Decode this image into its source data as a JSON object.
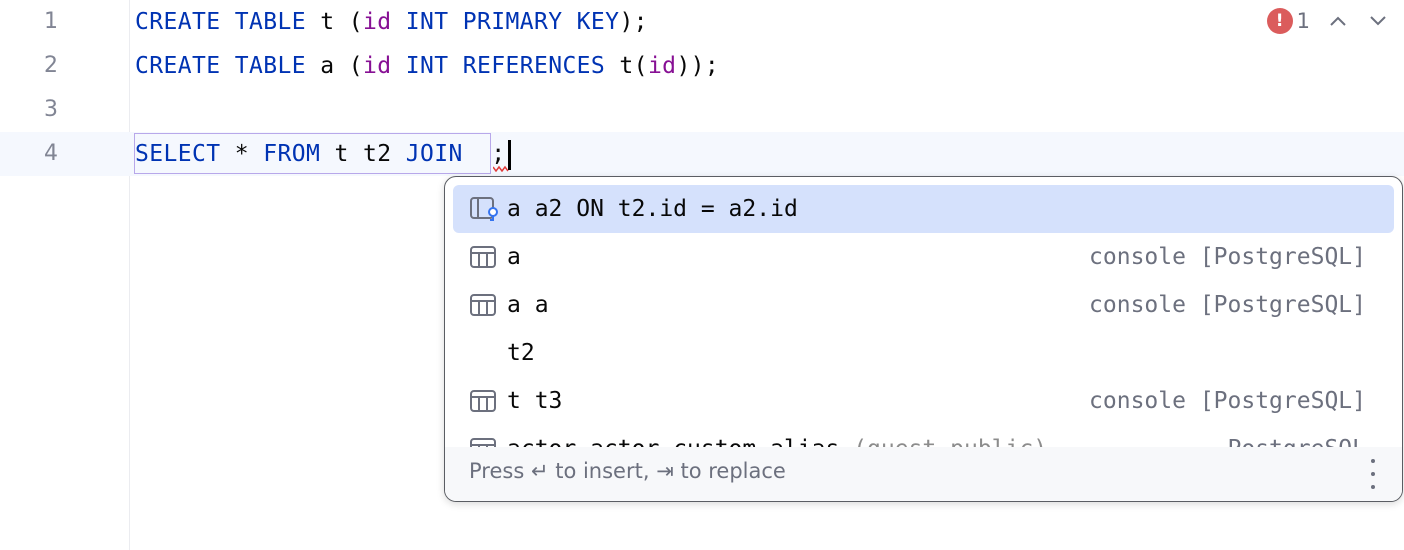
{
  "editor": {
    "line_numbers": [
      "1",
      "2",
      "3",
      "4"
    ],
    "lines": [
      {
        "tokens": [
          {
            "t": "CREATE TABLE",
            "c": "kw"
          },
          {
            "t": " t (",
            "c": ""
          },
          {
            "t": "id",
            "c": "fld"
          },
          {
            "t": " ",
            "c": ""
          },
          {
            "t": "INT PRIMARY KEY",
            "c": "kw"
          },
          {
            "t": ");",
            "c": ""
          }
        ]
      },
      {
        "tokens": [
          {
            "t": "CREATE TABLE",
            "c": "kw"
          },
          {
            "t": " a (",
            "c": ""
          },
          {
            "t": "id",
            "c": "fld"
          },
          {
            "t": " ",
            "c": ""
          },
          {
            "t": "INT REFERENCES",
            "c": "kw"
          },
          {
            "t": " t(",
            "c": ""
          },
          {
            "t": "id",
            "c": "fld"
          },
          {
            "t": "));",
            "c": ""
          }
        ]
      },
      {
        "tokens": []
      },
      {
        "tokens": [
          {
            "t": "SELECT",
            "c": "kw"
          },
          {
            "t": " * ",
            "c": ""
          },
          {
            "t": "FROM",
            "c": "kw"
          },
          {
            "t": " t t2 ",
            "c": ""
          },
          {
            "t": "JOIN",
            "c": "kw"
          },
          {
            "t": "  ;",
            "c": ""
          }
        ]
      }
    ]
  },
  "inspections": {
    "error_count": "1",
    "error_icon": "!"
  },
  "completion": {
    "items": [
      {
        "icon": "join-icon",
        "text": "a a2 ON t2.id = a2.id",
        "hint": "",
        "tail": "",
        "selected": true
      },
      {
        "icon": "table-icon",
        "text": "a",
        "hint": "",
        "tail": "console [PostgreSQL]",
        "selected": false
      },
      {
        "icon": "table-icon",
        "text": "a a",
        "hint": "",
        "tail": "console [PostgreSQL]",
        "selected": false
      },
      {
        "icon": "",
        "text": "t2",
        "hint": "",
        "tail": "",
        "selected": false
      },
      {
        "icon": "table-icon",
        "text": "t t3",
        "hint": "",
        "tail": "console [PostgreSQL]",
        "selected": false
      },
      {
        "icon": "table-icon",
        "text": "actor actor_custom_alias",
        "hint": " (guest.public)",
        "tail": "PostgreSQL",
        "selected": false
      }
    ],
    "footer_text": "Press ↵ to insert, ⇥ to replace"
  }
}
